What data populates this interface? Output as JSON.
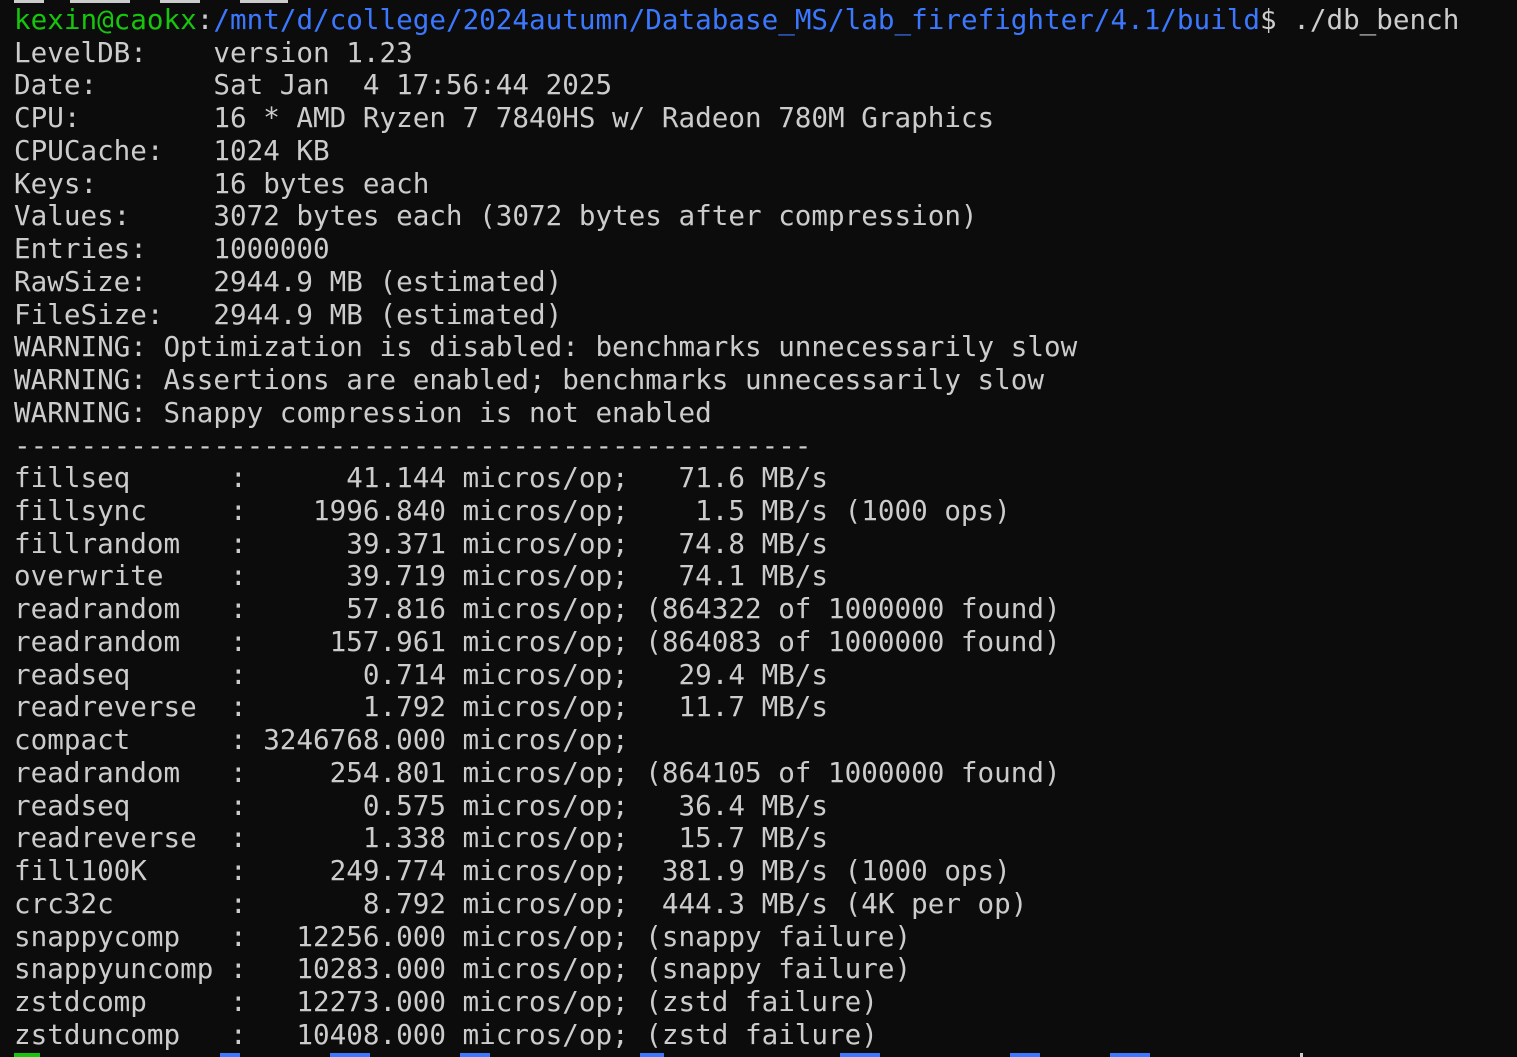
{
  "terminal": {
    "background_color": "#0c0c0c",
    "text_color": "#cccccc",
    "prompt": {
      "user_host": "kexin@caokx",
      "separator": ":",
      "path": "/mnt/d/college/2024autumn/Database_MS/lab_firefighter/4.1/build",
      "dollar": "$",
      "command": "./db_bench",
      "user_color": "#16c60c",
      "path_color": "#3b78ff"
    },
    "output_lines": [
      "LevelDB:    version 1.23",
      "Date:       Sat Jan  4 17:56:44 2025",
      "CPU:        16 * AMD Ryzen 7 7840HS w/ Radeon 780M Graphics",
      "CPUCache:   1024 KB",
      "Keys:       16 bytes each",
      "Values:     3072 bytes each (3072 bytes after compression)",
      "Entries:    1000000",
      "RawSize:    2944.9 MB (estimated)",
      "FileSize:   2944.9 MB (estimated)",
      "WARNING: Optimization is disabled: benchmarks unnecessarily slow",
      "WARNING: Assertions are enabled; benchmarks unnecessarily slow",
      "WARNING: Snappy compression is not enabled",
      "------------------------------------------------",
      "fillseq      :      41.144 micros/op;   71.6 MB/s",
      "fillsync     :    1996.840 micros/op;    1.5 MB/s (1000 ops)",
      "fillrandom   :      39.371 micros/op;   74.8 MB/s",
      "overwrite    :      39.719 micros/op;   74.1 MB/s",
      "readrandom   :      57.816 micros/op; (864322 of 1000000 found)",
      "readrandom   :     157.961 micros/op; (864083 of 1000000 found)",
      "readseq      :       0.714 micros/op;   29.4 MB/s",
      "readreverse  :       1.792 micros/op;   11.7 MB/s",
      "compact      : 3246768.000 micros/op;",
      "readrandom   :     254.801 micros/op; (864105 of 1000000 found)",
      "readseq      :       0.575 micros/op;   36.4 MB/s",
      "readreverse  :       1.338 micros/op;   15.7 MB/s",
      "fill100K     :     249.774 micros/op;  381.9 MB/s (1000 ops)",
      "crc32c       :       8.792 micros/op;  444.3 MB/s (4K per op)",
      "snappycomp   :   12256.000 micros/op; (snappy failure)",
      "snappyuncomp :   10283.000 micros/op; (snappy failure)",
      "zstdcomp     :   12273.000 micros/op; (zstd failure)",
      "zstduncomp   :   10408.000 micros/op; (zstd failure)"
    ]
  }
}
